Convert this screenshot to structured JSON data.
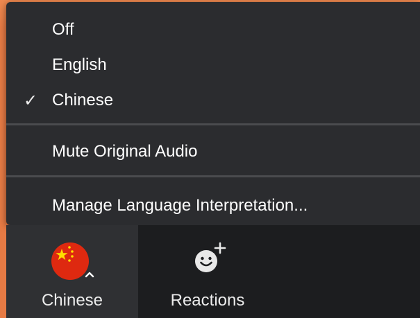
{
  "menu": {
    "items": [
      {
        "label": "Off",
        "checked": false
      },
      {
        "label": "English",
        "checked": false
      },
      {
        "label": "Chinese",
        "checked": true
      },
      {
        "label": "Mute Original Audio",
        "checked": false
      },
      {
        "label": "Manage Language Interpretation...",
        "checked": false
      }
    ],
    "check_glyph": "✓"
  },
  "toolbar": {
    "language_button": {
      "label": "Chinese",
      "icon": "china-flag-icon"
    },
    "reactions_button": {
      "label": "Reactions",
      "icon": "add-reaction-icon"
    }
  },
  "colors": {
    "menu_bg": "#2b2c2f",
    "toolbar_bg": "#1c1d1f",
    "active_button_bg": "#2f3033",
    "separator": "#4a4b4e",
    "text": "#ffffff",
    "desktop_bg": "#e67a44",
    "flag_red": "#de2910",
    "flag_yellow": "#ffde00"
  }
}
